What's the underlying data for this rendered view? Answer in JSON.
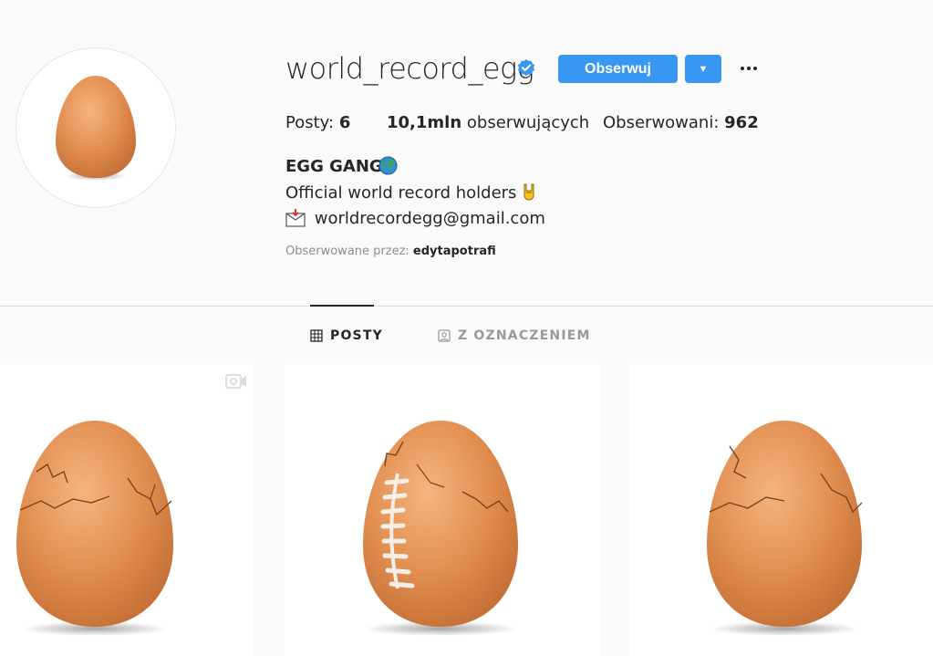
{
  "profile": {
    "username": "world_record_egg",
    "follow_label": "Obserwuj",
    "dropdown_label": "▼"
  },
  "stats": {
    "posts_label": "Posty:",
    "posts_value": "6",
    "followers_value": "10,1mln",
    "followers_label": "obserwujących",
    "following_label": "Obserwowani:",
    "following_value": "962"
  },
  "bio": {
    "name": "EGG GANG",
    "line1": "Official world record holders",
    "email": "worldrecordegg@gmail.com",
    "followed_by_label": "Obserwowane przez:",
    "followed_by_user": "edytapotrafi"
  },
  "tabs": [
    {
      "label": "POSTY",
      "icon": "grid-icon",
      "active": true
    },
    {
      "label": "Z OZNACZENIEM",
      "icon": "tagged-icon",
      "active": false
    }
  ],
  "posts": [
    {
      "type": "video",
      "variant": "cracked-egg"
    },
    {
      "type": "image",
      "variant": "football-egg"
    },
    {
      "type": "image",
      "variant": "cracked-egg"
    }
  ],
  "colors": {
    "accent": "#3897f0",
    "egg": "#e8965a",
    "background": "#fafafa"
  }
}
